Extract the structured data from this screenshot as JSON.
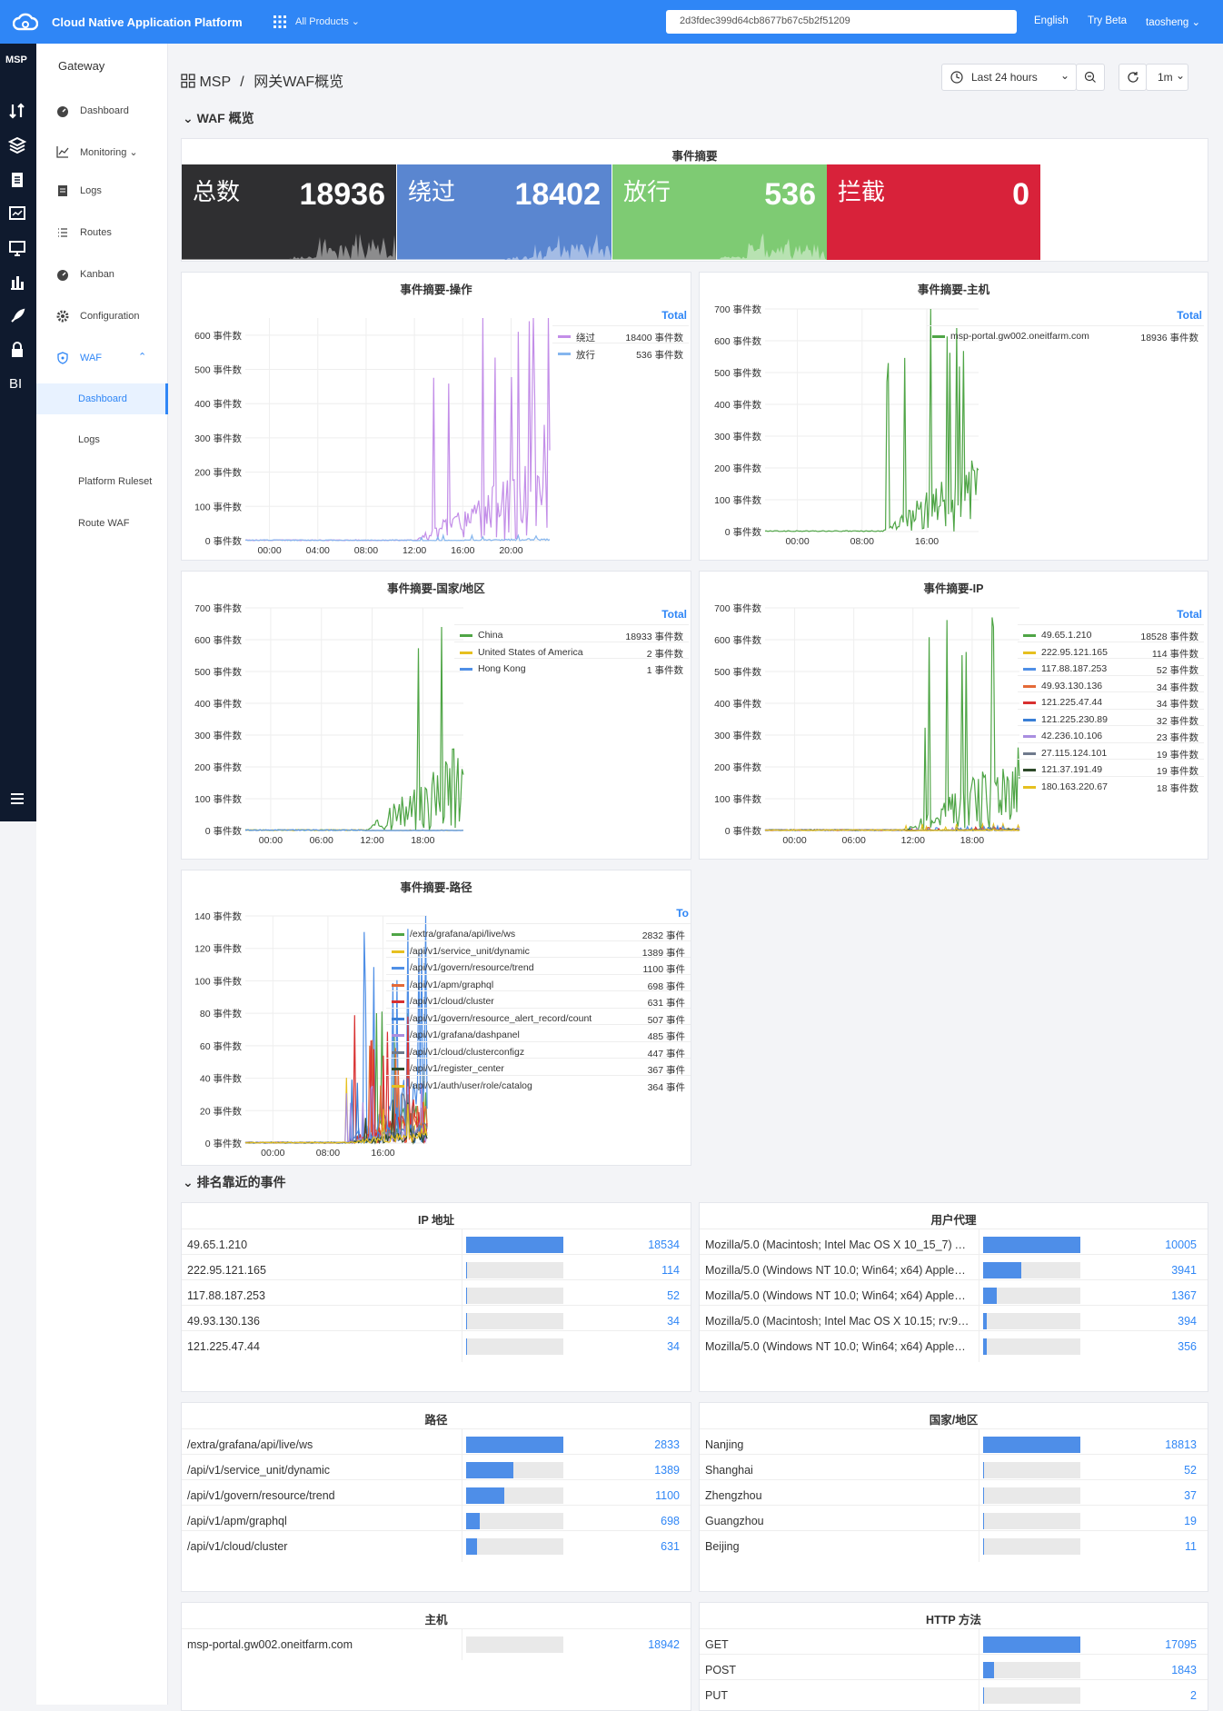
{
  "topbar": {
    "app_title": "Cloud Native Application Platform",
    "all_products": "All Products",
    "search_value": "2d3fdec399d64cb8677b67c5b2f51209",
    "language": "English",
    "try_beta": "Try Beta",
    "user": "taosheng"
  },
  "iconbar": {
    "msp": "MSP",
    "icons": [
      "sort-icon",
      "layers-icon",
      "clipboard-icon",
      "dashboard-icon",
      "monitor-icon",
      "bar-chart-icon",
      "rocket-icon",
      "lock-icon",
      "bi-icon"
    ],
    "menu": "menu-icon"
  },
  "sidenav": {
    "section": "Gateway",
    "items": [
      {
        "label": "Dashboard",
        "icon": "dashboard-icon"
      },
      {
        "label": "Monitoring",
        "icon": "line-chart-icon"
      },
      {
        "label": "Logs",
        "icon": "clipboard-icon"
      },
      {
        "label": "Routes",
        "icon": "list-icon"
      },
      {
        "label": "Kanban",
        "icon": "dashboard-icon"
      },
      {
        "label": "Configuration",
        "icon": "gear-icon"
      },
      {
        "label": "WAF",
        "icon": "shield-icon"
      }
    ],
    "waf_sub": [
      "Dashboard",
      "Logs",
      "Platform Ruleset",
      "Route WAF"
    ]
  },
  "breadcrumb": {
    "root": "MSP",
    "sep": "/",
    "page": "网关WAF概览"
  },
  "toolbar": {
    "time_range": "Last 24 hours",
    "refresh": "1m"
  },
  "sections": {
    "overview": "WAF 概览",
    "recent": "排名靠近的事件"
  },
  "summary": {
    "title": "事件摘要",
    "cards": [
      {
        "label": "总数",
        "value": "18936",
        "color": "#2f2f31"
      },
      {
        "label": "绕过",
        "value": "18402",
        "color": "#5a86d0"
      },
      {
        "label": "放行",
        "value": "536",
        "color": "#7ecb73"
      },
      {
        "label": "拦截",
        "value": "0",
        "color": "#d8223a"
      }
    ]
  },
  "chart_data": [
    {
      "type": "line",
      "title": "事件摘要-操作",
      "legend_header": "Total",
      "unit": "事件数",
      "ylim": [
        0,
        650
      ],
      "y_ticks": [
        "0 事件数",
        "100 事件数",
        "200 事件数",
        "300 事件数",
        "400 事件数",
        "500 事件数",
        "600 事件数"
      ],
      "x_ticks": [
        "00:00",
        "04:00",
        "08:00",
        "12:00",
        "16:00",
        "20:00"
      ],
      "series": [
        {
          "name": "绕过",
          "total": "18400 事件数",
          "color": "#c38ee8",
          "peak": 610
        },
        {
          "name": "放行",
          "total": "536 事件数",
          "color": "#85b6ee",
          "peak": 15
        }
      ]
    },
    {
      "type": "line",
      "title": "事件摘要-主机",
      "legend_header": "Total",
      "unit": "事件数",
      "ylim": [
        0,
        700
      ],
      "y_ticks": [
        "0 事件数",
        "100 事件数",
        "200 事件数",
        "300 事件数",
        "400 事件数",
        "500 事件数",
        "600 事件数",
        "700 事件数"
      ],
      "x_ticks": [
        "00:00",
        "08:00",
        "16:00"
      ],
      "series": [
        {
          "name": "msp-portal.gw002.oneitfarm.com",
          "total": "18936 事件数",
          "color": "#4fa546",
          "peak": 640
        }
      ]
    },
    {
      "type": "line",
      "title": "事件摘要-国家/地区",
      "legend_header": "Total",
      "unit": "事件数",
      "ylim": [
        0,
        700
      ],
      "y_ticks": [
        "0 事件数",
        "100 事件数",
        "200 事件数",
        "300 事件数",
        "400 事件数",
        "500 事件数",
        "600 事件数",
        "700 事件数"
      ],
      "x_ticks": [
        "00:00",
        "06:00",
        "12:00",
        "18:00"
      ],
      "series": [
        {
          "name": "China",
          "total": "18933 事件数",
          "color": "#4fa546",
          "peak": 640
        },
        {
          "name": "United States of America",
          "total": "2 事件数",
          "color": "#e6c020",
          "peak": 2
        },
        {
          "name": "Hong Kong",
          "total": "1 事件数",
          "color": "#4f8fe6",
          "peak": 1
        }
      ]
    },
    {
      "type": "line",
      "title": "事件摘要-IP",
      "legend_header": "Total",
      "unit": "事件数",
      "ylim": [
        0,
        700
      ],
      "y_ticks": [
        "0 事件数",
        "100 事件数",
        "200 事件数",
        "300 事件数",
        "400 事件数",
        "500 事件数",
        "600 事件数",
        "700 事件数"
      ],
      "x_ticks": [
        "00:00",
        "06:00",
        "12:00",
        "18:00"
      ],
      "series": [
        {
          "name": "49.65.1.210",
          "total": "18528 事件数",
          "color": "#4fa546",
          "peak": 640
        },
        {
          "name": "222.95.121.165",
          "total": "114 事件数",
          "color": "#e6c020",
          "peak": 20
        },
        {
          "name": "117.88.187.253",
          "total": "52 事件数",
          "color": "#4f8fe6",
          "peak": 12
        },
        {
          "name": "49.93.130.136",
          "total": "34 事件数",
          "color": "#e46a38",
          "peak": 10
        },
        {
          "name": "121.225.47.44",
          "total": "34 事件数",
          "color": "#d83030",
          "peak": 10
        },
        {
          "name": "121.225.230.89",
          "total": "32 事件数",
          "color": "#3a7fd6",
          "peak": 9
        },
        {
          "name": "42.236.10.106",
          "total": "23 事件数",
          "color": "#a98ee0",
          "peak": 8
        },
        {
          "name": "27.115.124.101",
          "total": "19 事件数",
          "color": "#6f7a8c",
          "peak": 7
        },
        {
          "name": "121.37.191.49",
          "total": "19 事件数",
          "color": "#2e4a2a",
          "peak": 7
        },
        {
          "name": "180.163.220.67",
          "total": "18 事件数",
          "color": "#e6c020",
          "peak": 6
        }
      ]
    },
    {
      "type": "line",
      "title": "事件摘要-路径",
      "legend_header": "To",
      "unit": "事件数",
      "ylim": [
        0,
        140
      ],
      "y_ticks": [
        "0 事件数",
        "20 事件数",
        "40 事件数",
        "60 事件数",
        "80 事件数",
        "100 事件数",
        "120 事件数",
        "140 事件数"
      ],
      "x_ticks": [
        "00:00",
        "08:00",
        "16:00"
      ],
      "series": [
        {
          "name": "/extra/grafana/api/live/ws",
          "total": "2832 事件",
          "color": "#4fa546",
          "peak": 80
        },
        {
          "name": "/api/v1/service_unit/dynamic",
          "total": "1389 事件",
          "color": "#e6c020",
          "peak": 50
        },
        {
          "name": "/api/v1/govern/resource/trend",
          "total": "1100 事件",
          "color": "#4f8fe6",
          "peak": 132
        },
        {
          "name": "/api/v1/apm/graphql",
          "total": "698 事件",
          "color": "#e46a38",
          "peak": 60
        },
        {
          "name": "/api/v1/cloud/cluster",
          "total": "631 事件",
          "color": "#d83030",
          "peak": 78
        },
        {
          "name": "/api/v1/govern/resource_alert_record/count",
          "total": "507 事件",
          "color": "#3a7fd6",
          "peak": 40
        },
        {
          "name": "/api/v1/grafana/dashpanel",
          "total": "485 事件",
          "color": "#a98ee0",
          "peak": 35
        },
        {
          "name": "/api/v1/cloud/clusterconfigz",
          "total": "447 事件",
          "color": "#6f7a8c",
          "peak": 30
        },
        {
          "name": "/api/v1/register_center",
          "total": "367 事件",
          "color": "#2e4a2a",
          "peak": 25
        },
        {
          "name": "/api/v1/auth/user/role/catalog",
          "total": "364 事件",
          "color": "#e6c020",
          "peak": 24
        }
      ]
    }
  ],
  "tables": [
    {
      "title": "IP 地址",
      "rows": [
        {
          "label": "49.65.1.210",
          "value": "18534",
          "ratio": 1
        },
        {
          "label": "222.95.121.165",
          "value": "114",
          "ratio": 0.006
        },
        {
          "label": "117.88.187.253",
          "value": "52",
          "ratio": 0.003
        },
        {
          "label": "49.93.130.136",
          "value": "34",
          "ratio": 0.002
        },
        {
          "label": "121.225.47.44",
          "value": "34",
          "ratio": 0.002
        }
      ]
    },
    {
      "title": "用户代理",
      "rows": [
        {
          "label": "Mozilla/5.0 (Macintosh; Intel Mac OS X 10_15_7) Apple...",
          "value": "10005",
          "ratio": 1
        },
        {
          "label": "Mozilla/5.0 (Windows NT 10.0; Win64; x64) AppleWebKit...",
          "value": "3941",
          "ratio": 0.39
        },
        {
          "label": "Mozilla/5.0 (Windows NT 10.0; Win64; x64) AppleWebKit...",
          "value": "1367",
          "ratio": 0.137
        },
        {
          "label": "Mozilla/5.0 (Macintosh; Intel Mac OS X 10.15; rv:93.0) G...",
          "value": "394",
          "ratio": 0.039
        },
        {
          "label": "Mozilla/5.0 (Windows NT 10.0; Win64; x64) AppleWebKit...",
          "value": "356",
          "ratio": 0.036
        }
      ]
    },
    {
      "title": "路径",
      "rows": [
        {
          "label": "/extra/grafana/api/live/ws",
          "value": "2833",
          "ratio": 1
        },
        {
          "label": "/api/v1/service_unit/dynamic",
          "value": "1389",
          "ratio": 0.49
        },
        {
          "label": "/api/v1/govern/resource/trend",
          "value": "1100",
          "ratio": 0.39
        },
        {
          "label": "/api/v1/apm/graphql",
          "value": "698",
          "ratio": 0.14
        },
        {
          "label": "/api/v1/cloud/cluster",
          "value": "631",
          "ratio": 0.11
        }
      ]
    },
    {
      "title": "国家/地区",
      "rows": [
        {
          "label": "Nanjing",
          "value": "18813",
          "ratio": 1
        },
        {
          "label": "Shanghai",
          "value": "52",
          "ratio": 0.003
        },
        {
          "label": "Zhengzhou",
          "value": "37",
          "ratio": 0.002
        },
        {
          "label": "Guangzhou",
          "value": "19",
          "ratio": 0.001
        },
        {
          "label": "Beijing",
          "value": "11",
          "ratio": 0.001
        }
      ]
    },
    {
      "title": "主机",
      "rows": [
        {
          "label": "msp-portal.gw002.oneitfarm.com",
          "value": "18942",
          "ratio": 0
        }
      ]
    },
    {
      "title": "HTTP 方法",
      "rows": [
        {
          "label": "GET",
          "value": "17095",
          "ratio": 1
        },
        {
          "label": "POST",
          "value": "1843",
          "ratio": 0.11
        },
        {
          "label": "PUT",
          "value": "2",
          "ratio": 0.001
        }
      ]
    }
  ]
}
